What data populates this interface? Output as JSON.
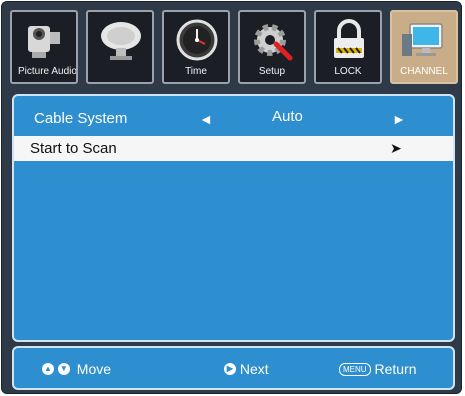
{
  "tabs": [
    {
      "label": "Picture Audio",
      "icon": "camcorder-icon",
      "active": false
    },
    {
      "label": "",
      "icon": "satellite-dish-icon",
      "active": false
    },
    {
      "label": "Time",
      "icon": "clock-icon",
      "active": false
    },
    {
      "label": "Setup",
      "icon": "gear-wrench-icon",
      "active": false
    },
    {
      "label": "LOCK",
      "icon": "padlock-icon",
      "active": false
    },
    {
      "label": "CHANNEL",
      "icon": "monitor-icon",
      "active": true
    }
  ],
  "menu": {
    "cable_system": {
      "label": "Cable System",
      "value": "Auto",
      "left_arrow": "◄",
      "right_arrow": "►"
    },
    "start_scan": {
      "label": "Start to Scan",
      "arrow": "➤"
    }
  },
  "footer": {
    "move_label": "Move",
    "next_label": "Next",
    "menu_key": "MENU",
    "return_label": "Return"
  },
  "colors": {
    "panel": "#2d8ed0",
    "active_tab": "#c9ad88",
    "frame": "#2e3a48"
  }
}
